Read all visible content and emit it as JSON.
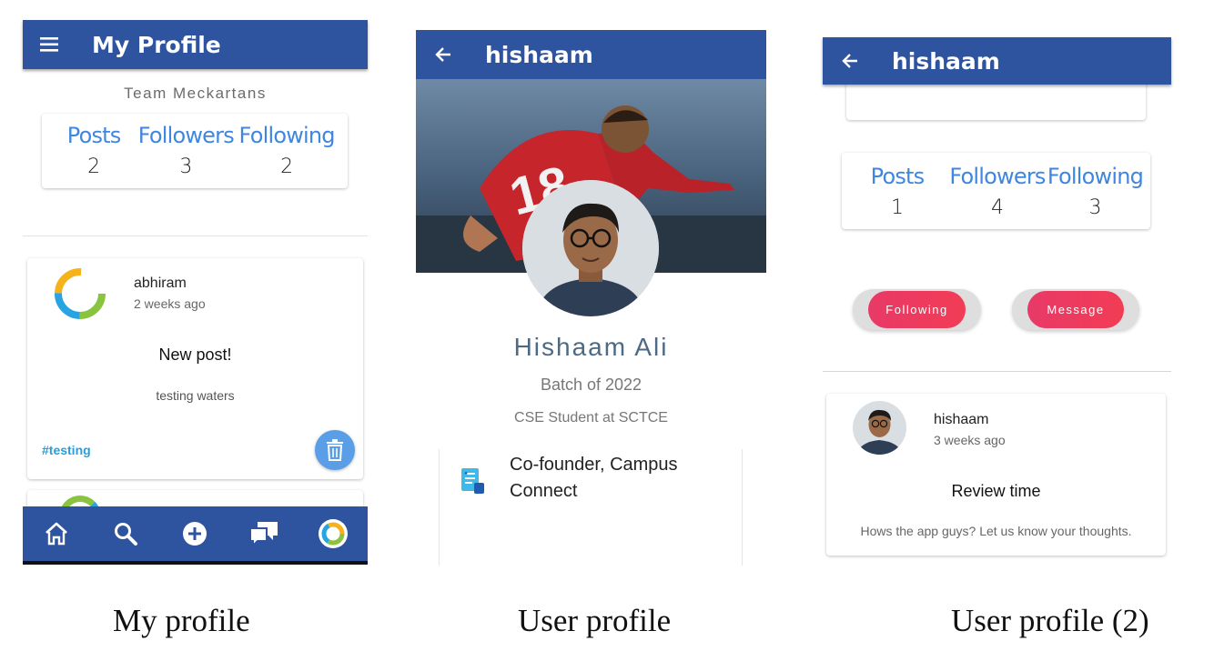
{
  "screen1": {
    "title": "My Profile",
    "team": "Team Meckartans",
    "stats": [
      {
        "label": "Posts",
        "value": "2"
      },
      {
        "label": "Followers",
        "value": "3"
      },
      {
        "label": "Following",
        "value": "2"
      }
    ],
    "post": {
      "author": "abhiram",
      "time": "2 weeks ago",
      "title": "New post!",
      "body": "testing waters",
      "tag": "#testing"
    },
    "icons": [
      "menu-icon",
      "home-icon",
      "search-icon",
      "add-circle-icon",
      "chat-icon",
      "avatar-ring-icon",
      "delete-icon"
    ],
    "caption": "My profile"
  },
  "screen2": {
    "title": "hishaam",
    "name": "Hishaam Ali",
    "batch": "Batch of 2022",
    "role": "CSE Student at SCTCE",
    "position_line1": "Co-founder, Campus",
    "position_line2": "Connect",
    "icons": [
      "back-arrow-icon",
      "document-icon"
    ],
    "caption": "User profile"
  },
  "screen3": {
    "title": "hishaam",
    "stats": [
      {
        "label": "Posts",
        "value": "1"
      },
      {
        "label": "Followers",
        "value": "4"
      },
      {
        "label": "Following",
        "value": "3"
      }
    ],
    "following_button": "Following",
    "message_button": "Message",
    "post": {
      "author": "hishaam",
      "time": "3 weeks ago",
      "title": "Review time",
      "body": "Hows the app guys? Let us know your thoughts."
    },
    "icons": [
      "back-arrow-icon"
    ],
    "caption": "User profile (2)"
  },
  "colors": {
    "appbar": "#2e54a0",
    "accent_blue": "#3f86e0",
    "button_pink": "#e83a68"
  }
}
